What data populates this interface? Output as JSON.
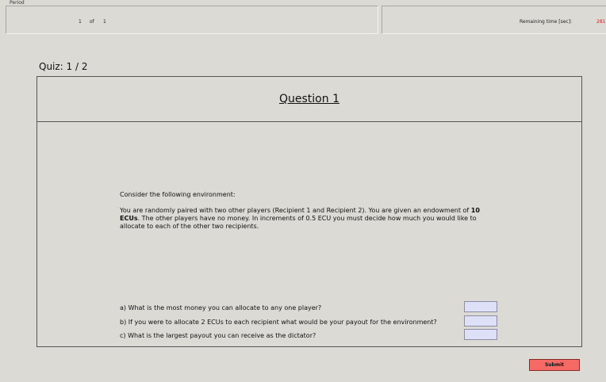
{
  "header": {
    "period_label": "Period",
    "period_current": "1",
    "period_of": "of",
    "period_total": "1",
    "remaining_label": "Remaining time [sec]:",
    "remaining_value": "281"
  },
  "quiz": {
    "progress": "Quiz: 1 / 2",
    "title": "Question 1",
    "intro": "Consider the following environment:",
    "scenario_part1": "You are randomly paired with two other players (Recipient 1 and Recipient 2). You are given an endowment of ",
    "scenario_bold": "10 ECUs",
    "scenario_part2": ". The other players have no money. In increments of 0.5 ECU you must decide how much you would like to allocate to each of the other two recipients.",
    "questions": [
      "a) What is the most money you can allocate to any one player?",
      "b) If you were to allocate 2 ECUs to each recipient what would be your payout for the environment?",
      "c) What is the largest payout you can receive as the dictator?"
    ],
    "answers": [
      "",
      "",
      ""
    ]
  },
  "submit_label": "Submit",
  "colors": {
    "background": "#dcdad5",
    "input_bg": "#dde0f7",
    "submit_bg": "#f66a66",
    "remaining_value": "#d02020"
  }
}
